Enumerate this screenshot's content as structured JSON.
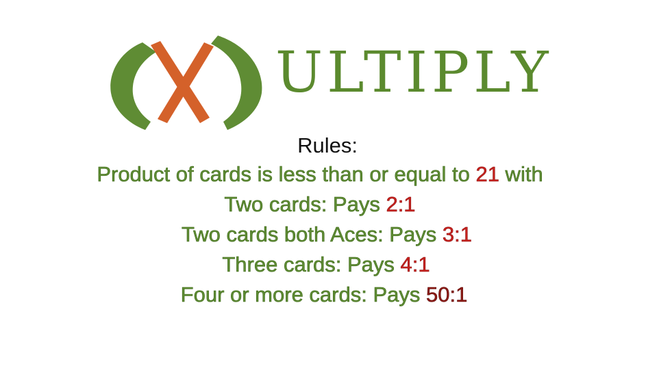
{
  "logo": {
    "wordmark": "ULTIPLY",
    "colors": {
      "green": "#5f8c34",
      "orange": "#d4612a"
    }
  },
  "rules": {
    "title": "Rules:",
    "lines": [
      {
        "text": "Product of cards is less than or equal to ",
        "highlight": "21",
        "suffix": " with"
      },
      {
        "text": "Two cards: Pays ",
        "highlight": "2:1",
        "suffix": ""
      },
      {
        "text": "Two cards both Aces: Pays ",
        "highlight": "3:1",
        "suffix": ""
      },
      {
        "text": "Three cards: Pays ",
        "highlight": "4:1",
        "suffix": ""
      },
      {
        "text": "Four or more cards: Pays ",
        "highlight": "50:1",
        "suffix": ""
      }
    ],
    "colors": {
      "text": "#5f8c34",
      "highlight": "#c8221f",
      "highlight_dark": "#8e1b16"
    }
  }
}
